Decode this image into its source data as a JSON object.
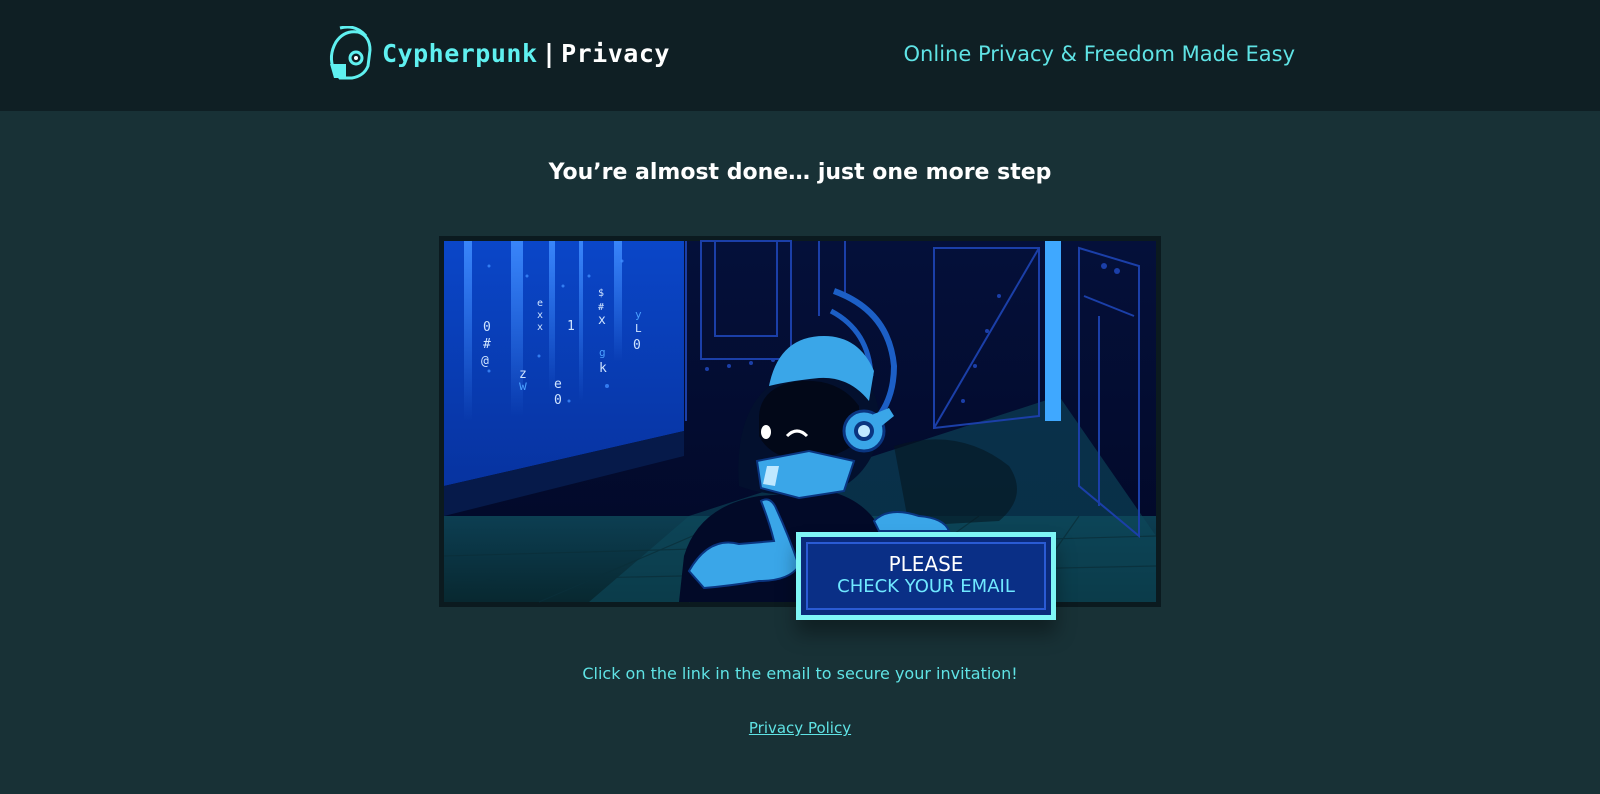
{
  "header": {
    "brand": "Cypherpunk",
    "separator": "|",
    "product": "Privacy",
    "tagline": "Online Privacy & Freedom Made Easy",
    "logo_icon": "helmet-icon"
  },
  "main": {
    "headline": "You’re almost done… just one more step",
    "illustration": {
      "sign_line1": "PLEASE",
      "sign_line2": "CHECK YOUR EMAIL",
      "code_rain": [
        "0",
        "#",
        "@",
        "z",
        "w",
        "e",
        "x",
        "x",
        "1",
        "e",
        "0",
        "$",
        "#",
        "x",
        "g",
        "k",
        "y",
        "L",
        "0"
      ]
    },
    "instruction": "Click on the link in the email to secure your invitation!",
    "privacy_link": "Privacy Policy"
  },
  "colors": {
    "page_bg": "#183136",
    "header_bg": "#0f1f24",
    "accent": "#5fe3e5",
    "sign_border": "#7ff6f6",
    "sign_bg": "#0a2f86"
  }
}
